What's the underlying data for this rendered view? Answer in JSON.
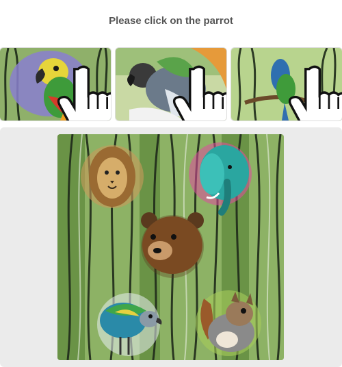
{
  "captcha": {
    "prompt": "Please click on the parrot",
    "examples": [
      {
        "subject": "parrot",
        "style": "watercolor-jungle"
      },
      {
        "subject": "parrot",
        "style": "watercolor-jungle"
      },
      {
        "subject": "parrot",
        "style": "watercolor-jungle"
      }
    ],
    "canvas_animals": [
      "lion",
      "elephant",
      "bear",
      "parrot",
      "squirrel"
    ],
    "colors": {
      "background_stage": "#ebebeb",
      "prompt_text": "#555555",
      "foliage_green": "#5f8a3a",
      "foliage_light": "#a9c97a",
      "stalk_dark": "#1f2a1a"
    }
  }
}
